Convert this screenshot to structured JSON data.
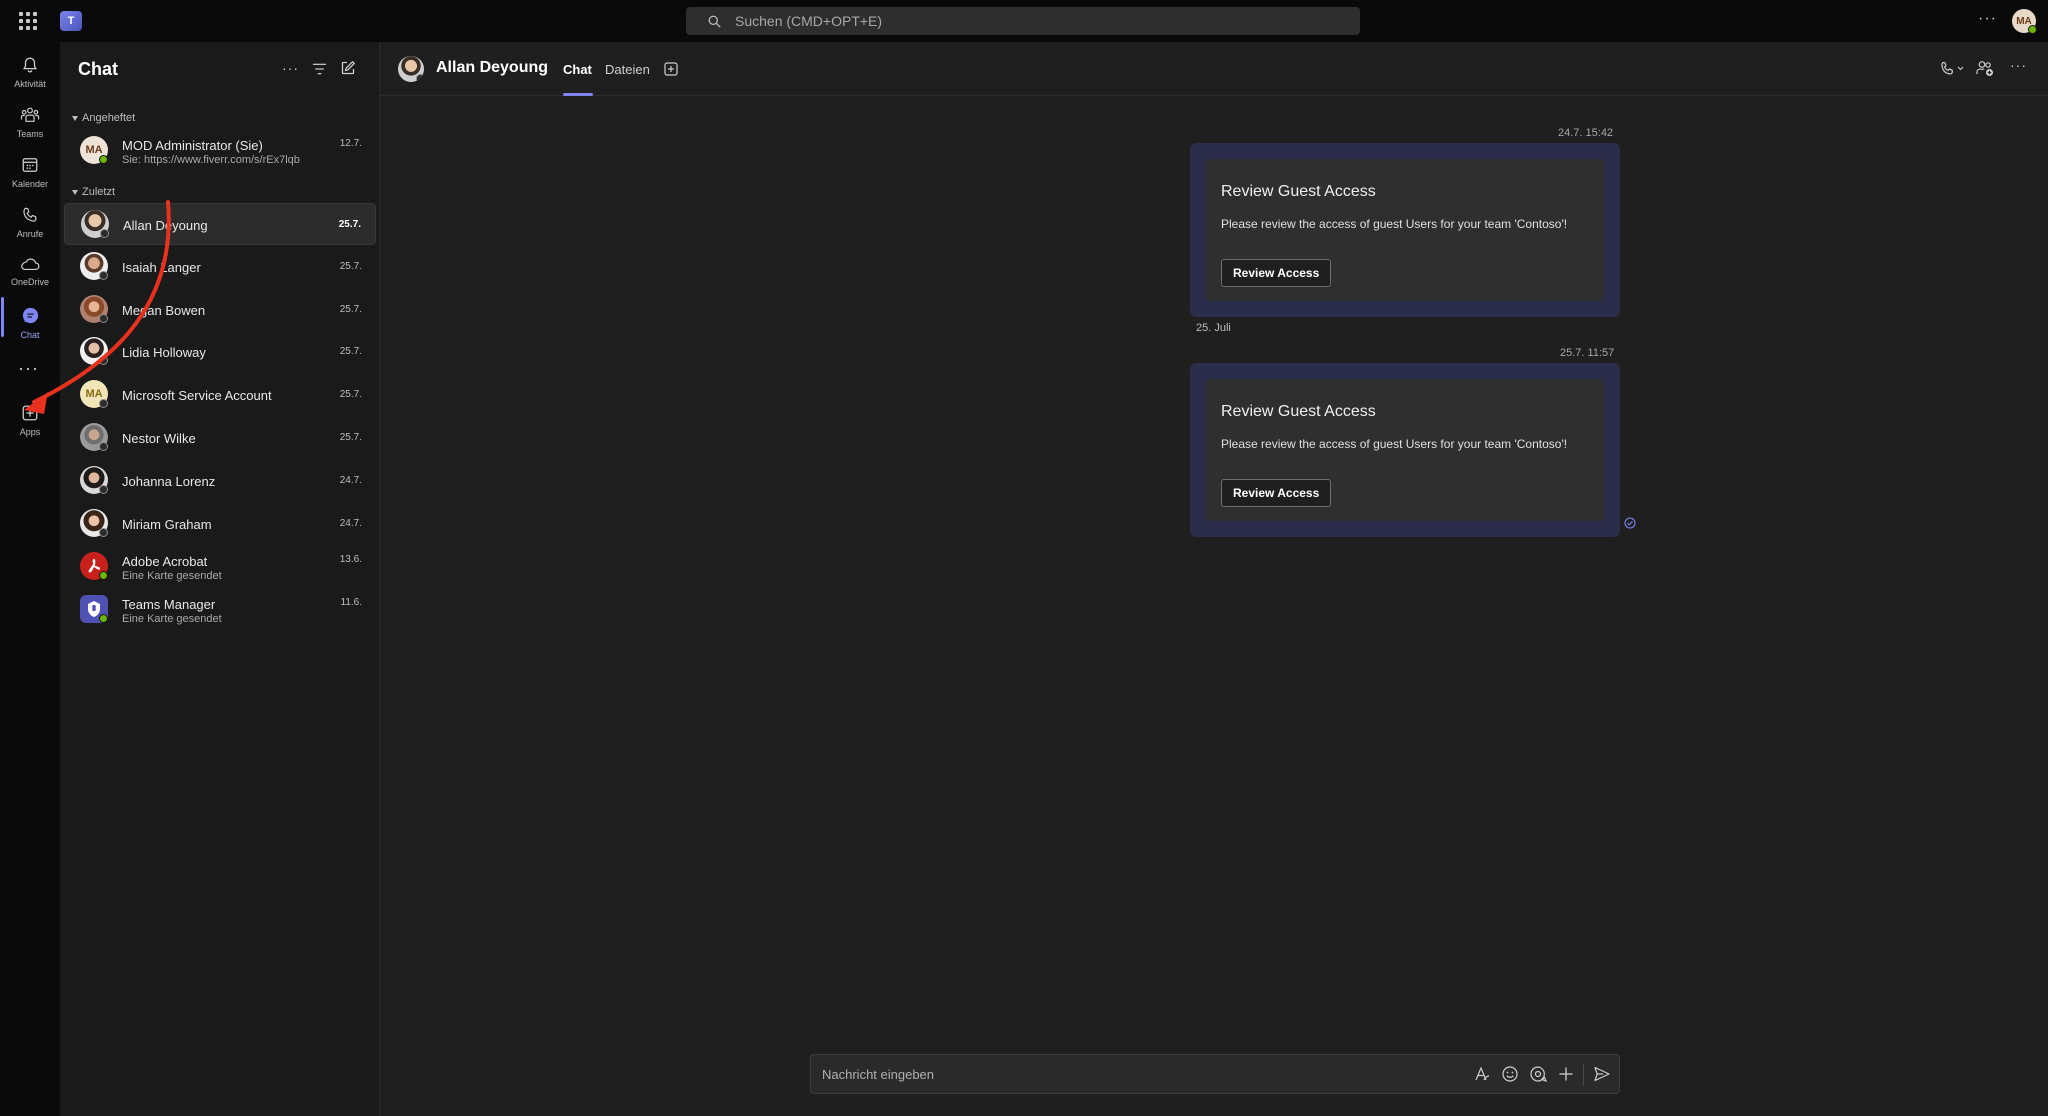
{
  "topbar": {
    "search_placeholder": "Suchen (CMD+OPT+E)",
    "more_label": "···",
    "user_initials": "MA",
    "app_logo_text": "T"
  },
  "rail": {
    "items": [
      {
        "label": "Aktivität",
        "icon": "bell-icon"
      },
      {
        "label": "Teams",
        "icon": "teams-icon"
      },
      {
        "label": "Kalender",
        "icon": "calendar-icon"
      },
      {
        "label": "Anrufe",
        "icon": "phone-icon"
      },
      {
        "label": "OneDrive",
        "icon": "cloud-icon"
      },
      {
        "label": "Chat",
        "icon": "chat-icon"
      },
      {
        "label": "Apps",
        "icon": "apps-add-icon"
      }
    ],
    "more_label": "···"
  },
  "chat_list": {
    "title": "Chat",
    "more_label": "···",
    "pinned_section": "Angeheftet",
    "recent_section": "Zuletzt",
    "pinned": [
      {
        "name": "MOD Administrator (Sie)",
        "preview": "Sie: https://www.fiverr.com/s/rEx7lqb",
        "date": "12.7.",
        "initials": "MA"
      }
    ],
    "recent": [
      {
        "name": "Allan Deyoung",
        "date": "25.7."
      },
      {
        "name": "Isaiah Langer",
        "date": "25.7."
      },
      {
        "name": "Megan Bowen",
        "date": "25.7."
      },
      {
        "name": "Lidia Holloway",
        "date": "25.7."
      },
      {
        "name": "Microsoft Service Account",
        "date": "25.7.",
        "initials": "MA"
      },
      {
        "name": "Nestor Wilke",
        "date": "25.7."
      },
      {
        "name": "Johanna Lorenz",
        "date": "24.7."
      },
      {
        "name": "Miriam Graham",
        "date": "24.7."
      },
      {
        "name": "Adobe Acrobat",
        "preview": "Eine Karte gesendet",
        "date": "13.6."
      },
      {
        "name": "Teams Manager",
        "preview": "Eine Karte gesendet",
        "date": "11.6."
      }
    ]
  },
  "conversation": {
    "contact_name": "Allan Deyoung",
    "tabs": [
      "Chat",
      "Dateien"
    ],
    "messages": [
      {
        "timestamp": "24.7. 15:42",
        "card_title": "Review Guest Access",
        "card_text": "Please review the access of guest Users for your team 'Contoso'!",
        "button_label": "Review Access"
      },
      {
        "timestamp": "25.7. 11:57",
        "card_title": "Review Guest Access",
        "card_text": "Please review the access of guest Users for your team 'Contoso'!",
        "button_label": "Review Access"
      }
    ],
    "date_separator": "25. Juli",
    "composer_placeholder": "Nachricht eingeben",
    "more_label": "···"
  },
  "colors": {
    "accent": "#7f85f5",
    "card_bubble": "#2b2d4a",
    "annotation_arrow": "#e8321e",
    "presence_available": "#6bb700"
  }
}
